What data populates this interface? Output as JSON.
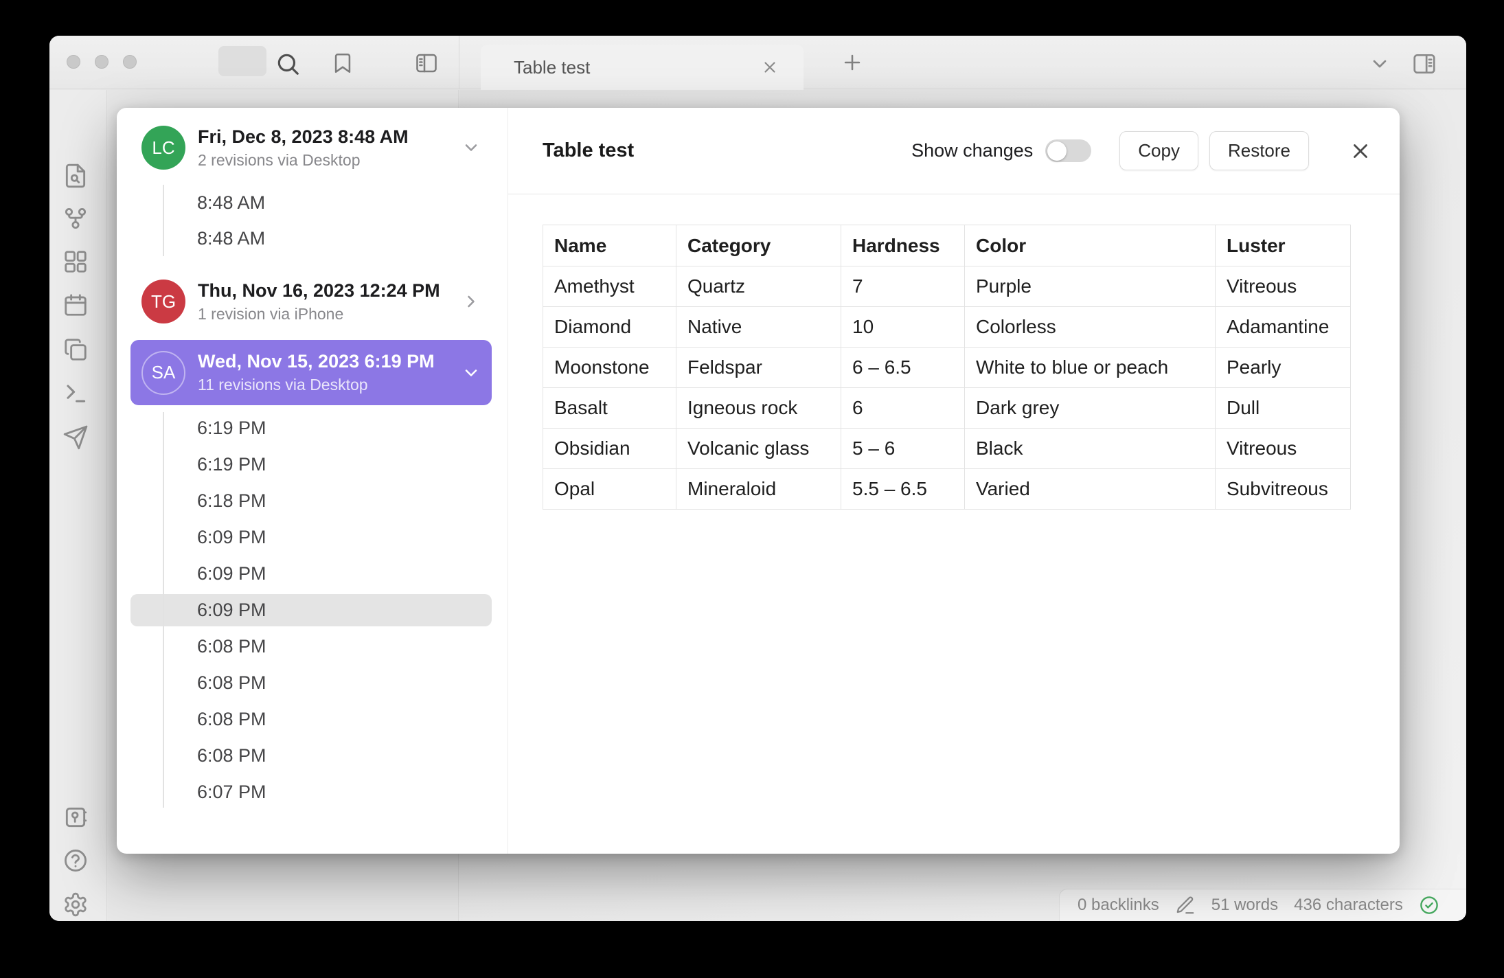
{
  "window": {
    "tab_title": "Table test",
    "toolbar_icons": [
      "folder",
      "search",
      "bookmark",
      "panel-left",
      "chevron-down",
      "panel-right",
      "plus"
    ],
    "rail_icons": [
      "file-search",
      "graph",
      "layout-dashboard",
      "calendar",
      "copy",
      "terminal",
      "send"
    ],
    "rail_bottom_icons": [
      "vault",
      "help",
      "settings"
    ]
  },
  "history": {
    "groups": [
      {
        "initials": "LC",
        "avatar_color": "#33a457",
        "title": "Fri, Dec 8, 2023 8:48 AM",
        "subtitle": "2 revisions via Desktop",
        "chevron": "down",
        "selected": false,
        "times": [
          "8:48 AM",
          "8:48 AM"
        ]
      },
      {
        "initials": "TG",
        "avatar_color": "#cb3a43",
        "title": "Thu, Nov 16, 2023 12:24 PM",
        "subtitle": "1 revision via iPhone",
        "chevron": "right",
        "selected": false,
        "times": []
      },
      {
        "initials": "SA",
        "avatar_color": "#8c77e5",
        "title": "Wed, Nov 15, 2023 6:19 PM",
        "subtitle": "11 revisions via Desktop",
        "chevron": "down",
        "selected": true,
        "selected_time_index": 5,
        "times": [
          "6:19 PM",
          "6:19 PM",
          "6:18 PM",
          "6:09 PM",
          "6:09 PM",
          "6:09 PM",
          "6:08 PM",
          "6:08 PM",
          "6:08 PM",
          "6:08 PM",
          "6:07 PM"
        ]
      }
    ]
  },
  "preview": {
    "title": "Table test",
    "show_changes_label": "Show changes",
    "toggle_on": false,
    "copy_label": "Copy",
    "restore_label": "Restore"
  },
  "table": {
    "headers": [
      "Name",
      "Category",
      "Hardness",
      "Color",
      "Luster"
    ],
    "rows": [
      [
        "Amethyst",
        "Quartz",
        "7",
        "Purple",
        "Vitreous"
      ],
      [
        "Diamond",
        "Native",
        "10",
        "Colorless",
        "Adamantine"
      ],
      [
        "Moonstone",
        "Feldspar",
        "6 – 6.5",
        "White to blue or peach",
        "Pearly"
      ],
      [
        "Basalt",
        "Igneous rock",
        "6",
        "Dark grey",
        "Dull"
      ],
      [
        "Obsidian",
        "Volcanic glass",
        "5 – 6",
        "Black",
        "Vitreous"
      ],
      [
        "Opal",
        "Mineraloid",
        "5.5 – 6.5",
        "Varied",
        "Subvitreous"
      ]
    ]
  },
  "status_bar": {
    "backlinks": "0 backlinks",
    "words": "51 words",
    "characters": "436 characters"
  },
  "colors": {
    "accent_purple": "#8c77e5",
    "avatar_green": "#33a457",
    "avatar_red": "#cb3a43",
    "status_check_green": "#45a85e"
  }
}
